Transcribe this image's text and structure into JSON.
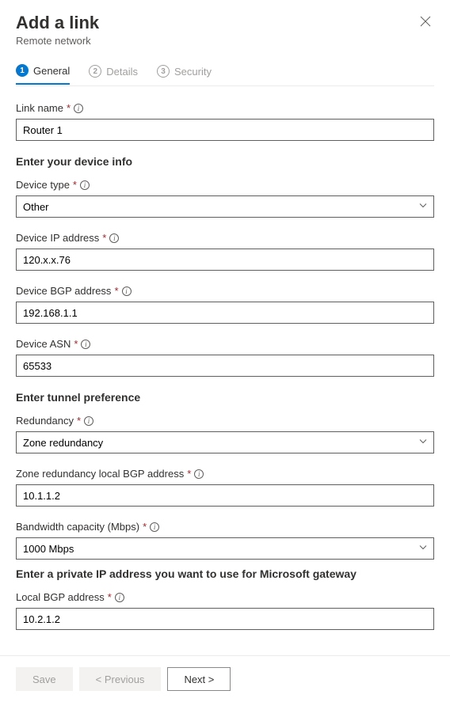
{
  "header": {
    "title": "Add a link",
    "subtitle": "Remote network"
  },
  "tabs": [
    {
      "num": "1",
      "label": "General"
    },
    {
      "num": "2",
      "label": "Details"
    },
    {
      "num": "3",
      "label": "Security"
    }
  ],
  "form": {
    "link_name": {
      "label": "Link name",
      "value": "Router 1"
    },
    "section1": "Enter your device info",
    "device_type": {
      "label": "Device type",
      "value": "Other"
    },
    "device_ip": {
      "label": "Device IP address",
      "value": "120.x.x.76"
    },
    "device_bgp": {
      "label": "Device BGP address",
      "value": "192.168.1.1"
    },
    "device_asn": {
      "label": "Device ASN",
      "value": "65533"
    },
    "section2": "Enter tunnel preference",
    "redundancy": {
      "label": "Redundancy",
      "value": "Zone redundancy"
    },
    "zone_bgp": {
      "label": "Zone redundancy local BGP address",
      "value": "10.1.1.2"
    },
    "bandwidth": {
      "label": "Bandwidth capacity (Mbps)",
      "value": "1000 Mbps"
    },
    "section3": "Enter a private IP address you want to use for Microsoft gateway",
    "local_bgp": {
      "label": "Local BGP address",
      "value": "10.2.1.2"
    }
  },
  "footer": {
    "save": "Save",
    "previous": "< Previous",
    "next": "Next >"
  },
  "required_marker": "*"
}
